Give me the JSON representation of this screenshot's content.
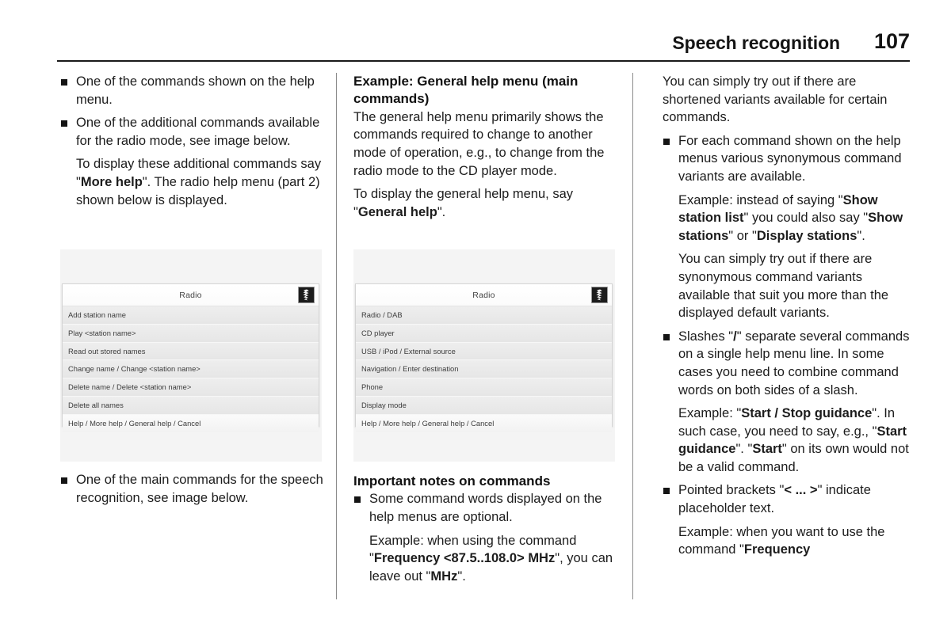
{
  "header": {
    "title": "Speech recognition",
    "page_number": "107"
  },
  "column1": {
    "bullet1": "One of the commands shown on the help menu.",
    "bullet2": "One of the additional commands available for the radio mode, see image below.",
    "para1_pre": "To display these additional commands say \"",
    "para1_bold": "More help",
    "para1_post": "\". The radio help menu (part 2) shown below is displayed.",
    "bullet3": "One of the main commands for the speech recognition, see image below.",
    "radio_menu": {
      "title": "Radio",
      "icon": "speech-recognition-icon",
      "rows": [
        "Add station name",
        "Play <station name>",
        "Read out stored names",
        "Change name / Change <station name>",
        "Delete name / Delete <station name>",
        "Delete all names",
        "Help / More help / General help / Cancel"
      ]
    }
  },
  "column2": {
    "heading": "Example: General help menu (main commands)",
    "para1": "The general help menu primarily shows the commands required to change to another mode of operation, e.g., to change from the radio mode to the CD player mode.",
    "para2_pre": "To display the general help menu, say \"",
    "para2_bold": "General help",
    "para2_post": "\".",
    "radio_menu": {
      "title": "Radio",
      "icon": "speech-recognition-icon",
      "rows": [
        "Radio / DAB",
        "CD player",
        "USB / iPod / External source",
        "Navigation / Enter destination",
        "Phone",
        "Display mode",
        "Help / More help / General help / Cancel"
      ]
    },
    "heading2": "Important notes on commands",
    "bullet1": "Some command words displayed on the help menus are optional.",
    "para3_pre": "Example: when using the command \"",
    "para3_bold1": "Frequency <87.5..108.0> MHz",
    "para3_mid": "\", you can leave out \"",
    "para3_bold2": "MHz",
    "para3_post": "\"."
  },
  "column3": {
    "para1": "You can simply try out if there are shortened variants available for certain commands.",
    "bullet1": "For each command shown on the help menus various synonymous command variants are available.",
    "para2_pre": "Example: instead of saying \"",
    "para2_bold1": "Show station list",
    "para2_mid1": "\" you could also say \"",
    "para2_bold2": "Show stations",
    "para2_mid2": "\" or \"",
    "para2_bold3": "Display stations",
    "para2_post": "\".",
    "para3": "You can simply try out if there are synonymous command variants available that suit you more than the displayed default variants.",
    "bullet2_pre": "Slashes \"",
    "bullet2_bold": "/",
    "bullet2_post": "\" separate several commands on a single help menu line. In some cases you need to combine command words on both sides of a slash.",
    "para4_pre": "Example: \"",
    "para4_bold1": "Start / Stop guidance",
    "para4_mid1": "\". In such case, you need to say, e.g., \"",
    "para4_bold2": "Start guidance",
    "para4_mid2": "\". \"",
    "para4_bold3": "Start",
    "para4_post": "\" on its own would not be a valid command.",
    "bullet3_pre": "Pointed brackets \"",
    "bullet3_bold": "< ... >",
    "bullet3_post": "\" indicate placeholder text.",
    "para5_pre": "Example: when you want to use the command \"",
    "para5_bold": "Frequency"
  }
}
